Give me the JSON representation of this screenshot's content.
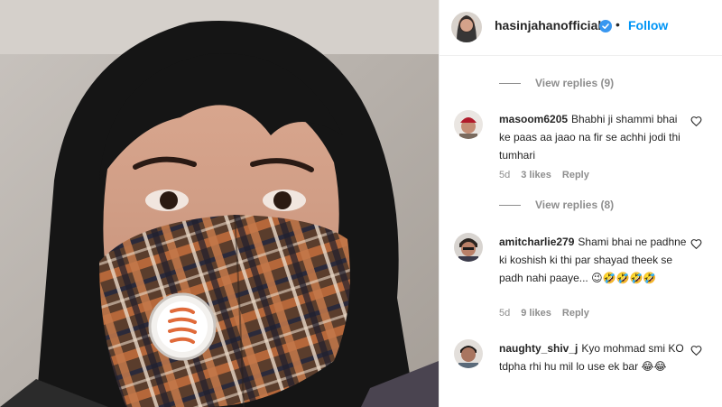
{
  "post": {
    "username": "hasinjahanofficial",
    "dot": "•",
    "follow_label": "Follow"
  },
  "replies_1": {
    "label": "View replies (9)"
  },
  "replies_2": {
    "label": "View replies (8)"
  },
  "comments": [
    {
      "username": "masoom6205",
      "text": "Bhabhi ji shammi bhai ke paas aa jaao na fir se achhi jodi thi tumhari",
      "time": "5d",
      "likes": "3 likes",
      "reply": "Reply"
    },
    {
      "username": "amitcharlie279",
      "text": "Shami bhai ne padhne ki koshish ki thi par shayad theek se padh nahi paaye...",
      "emojis": "😉🤣🤣🤣🤣",
      "time": "5d",
      "likes": "9 likes",
      "reply": "Reply"
    },
    {
      "username": "naughty_shiv_j",
      "text": "Kyo mohmad smi KO tdpha rhi hu mil lo use ek bar",
      "emojis": "😂😂"
    }
  ],
  "colors": {
    "link": "#0095f6",
    "verified": "#3897f0",
    "muted": "#8e8e8e",
    "text": "#262626"
  }
}
